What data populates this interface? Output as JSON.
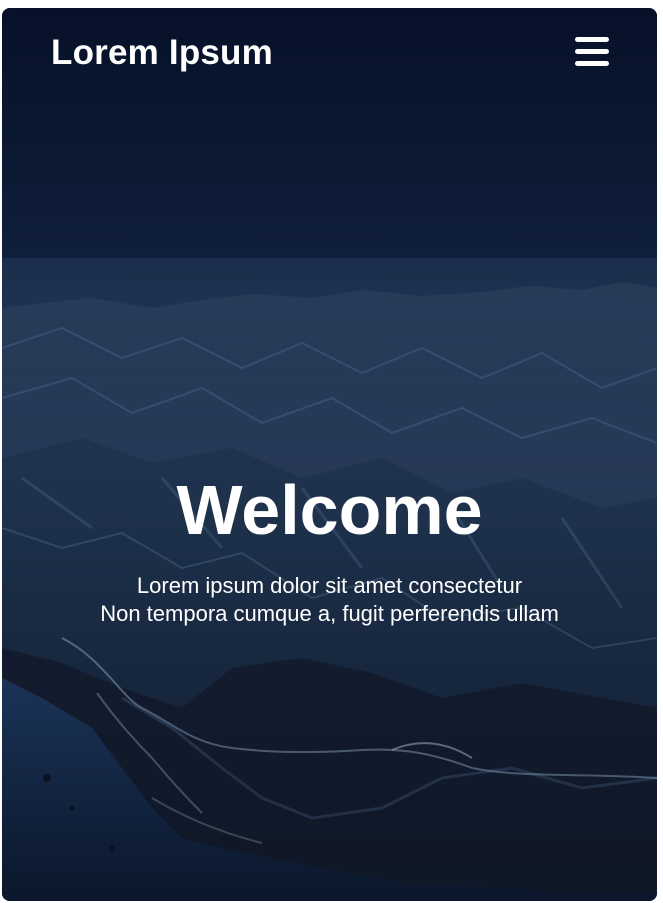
{
  "header": {
    "brand": "Lorem Ipsum",
    "menu_icon": "hamburger-menu-icon"
  },
  "hero": {
    "title": "Welcome",
    "subtitle_lines": [
      "Lorem ipsum dolor sit amet consectetur",
      "Non tempora cumque a, fugit perferendis ullam"
    ]
  },
  "colors": {
    "text": "#ffffff",
    "sky_top": "#081430",
    "sky_bottom": "#2a4568",
    "mountains": "#1b2b45",
    "ocean": "#14284a"
  }
}
